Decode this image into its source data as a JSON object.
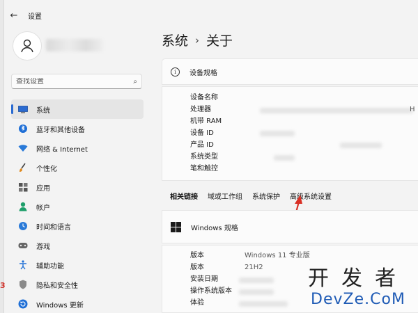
{
  "window": {
    "title": "设置"
  },
  "search": {
    "placeholder": "查找设置"
  },
  "sidebar": {
    "items": [
      {
        "label": "系统",
        "icon": "monitor-icon",
        "active": true
      },
      {
        "label": "蓝牙和其他设备",
        "icon": "bluetooth-icon"
      },
      {
        "label": "网络 & Internet",
        "icon": "wifi-icon"
      },
      {
        "label": "个性化",
        "icon": "brush-icon"
      },
      {
        "label": "应用",
        "icon": "apps-icon"
      },
      {
        "label": "帐户",
        "icon": "person-icon"
      },
      {
        "label": "时间和语言",
        "icon": "globe-clock-icon"
      },
      {
        "label": "游戏",
        "icon": "gamepad-icon"
      },
      {
        "label": "辅助功能",
        "icon": "accessibility-icon"
      },
      {
        "label": "隐私和安全性",
        "icon": "shield-icon"
      },
      {
        "label": "Windows 更新",
        "icon": "windows-update-icon"
      }
    ]
  },
  "breadcrumb": {
    "parent": "系统",
    "separator": "›",
    "current": "关于"
  },
  "device_specs": {
    "title": "设备规格",
    "rows": [
      {
        "label": "设备名称"
      },
      {
        "label": "处理器",
        "value_fragment": "H"
      },
      {
        "label": "机带 RAM"
      },
      {
        "label": "设备 ID"
      },
      {
        "label": "产品 ID"
      },
      {
        "label": "系统类型"
      },
      {
        "label": "笔和触控"
      }
    ]
  },
  "related_links": {
    "title": "相关链接",
    "links": [
      "域或工作组",
      "系统保护",
      "高级系统设置"
    ]
  },
  "windows_specs": {
    "title": "Windows 规格",
    "rows": [
      {
        "label": "版本",
        "value": "Windows 11 专业版"
      },
      {
        "label": "版本",
        "value": "21H2"
      },
      {
        "label": "安装日期",
        "value": ""
      },
      {
        "label": "操作系统版本",
        "value": ""
      },
      {
        "label": "体验",
        "value": ""
      }
    ]
  },
  "edge_mark": "3",
  "watermark": {
    "top": "开发者",
    "bottom": "DevZe.CoM"
  },
  "colors": {
    "accent": "#2b6bd1",
    "arrow": "#d93025",
    "watermark_blue": "#1f5bb5"
  }
}
